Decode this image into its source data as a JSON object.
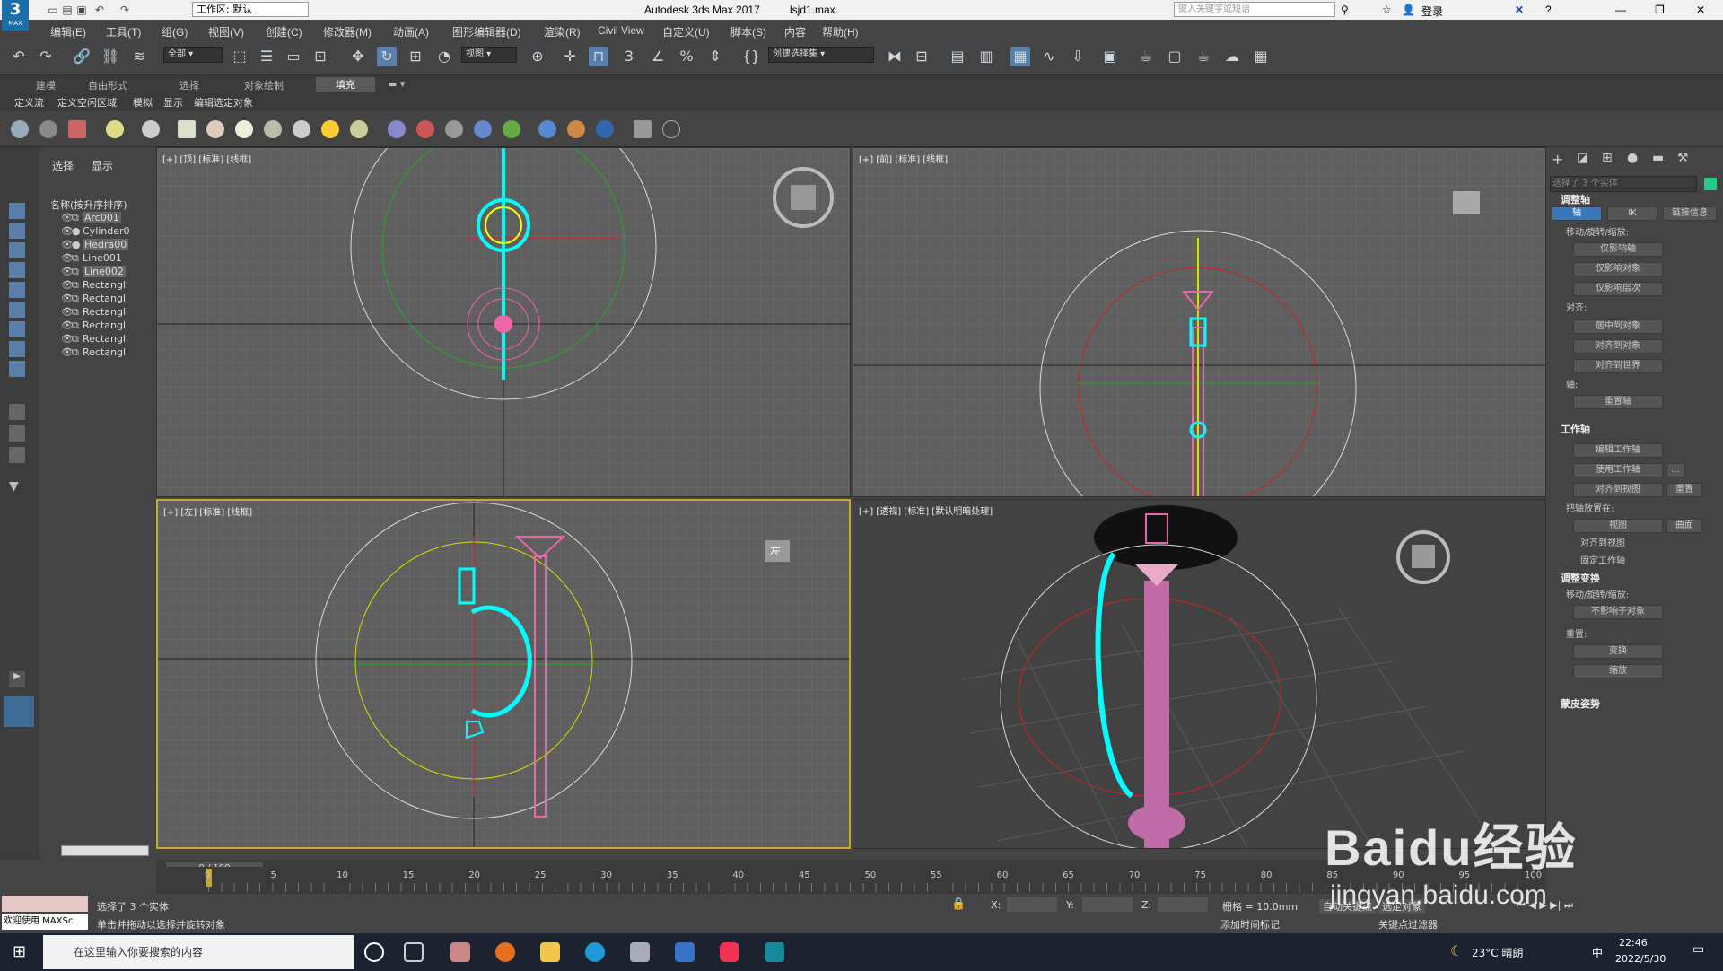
{
  "titlebar": {
    "app": "Autodesk 3ds Max 2017",
    "file": "lsjd1.max",
    "workspace": "工作区: 默认",
    "search_placeholder": "键入关键字或短语",
    "login": "登录",
    "logo": "3",
    "logo_sub": "MAX"
  },
  "menu": [
    "编辑(E)",
    "工具(T)",
    "组(G)",
    "视图(V)",
    "创建(C)",
    "修改器(M)",
    "动画(A)",
    "图形编辑器(D)",
    "渲染(R)",
    "Civil View",
    "自定义(U)",
    "脚本(S)",
    "内容",
    "帮助(H)"
  ],
  "toolbar": {
    "filter": "全部",
    "view_dropdown": "视图",
    "selection_set": "创建选择集"
  },
  "ribbon": {
    "tabs": [
      "建模",
      "自由形式",
      "选择",
      "对象绘制",
      "填充"
    ],
    "subtabs": [
      "定义流",
      "定义空闲区域",
      "模拟",
      "显示",
      "编辑选定对象"
    ]
  },
  "scene_explorer": {
    "tabs": [
      "选择",
      "显示"
    ],
    "header": "名称(按升序排序)",
    "items": [
      "Arc001",
      "Cylinder0",
      "Hedra00",
      "Line001",
      "Line002",
      "Rectangl",
      "Rectangl",
      "Rectangl",
      "Rectangl",
      "Rectangl",
      "Rectangl"
    ]
  },
  "viewports": {
    "top": "[+] [顶] [标准] [线框]",
    "front": "[+] [前] [标准] [线框]",
    "left": "[+] [左] [标准] [线框]",
    "persp": "[+] [透视] [标准] [默认明暗处理]",
    "viewcube_left": "左"
  },
  "command_panel": {
    "selection": "选择了 3 个实体",
    "tabs": [
      "轴",
      "IK",
      "链接信息"
    ],
    "adjust_pivot": "调整轴",
    "move_rotate_scale": "移动/旋转/缩放:",
    "btn_pivot_only": "仅影响轴",
    "btn_object_only": "仅影响对象",
    "btn_hierarchy_only": "仅影响层次",
    "align": "对齐:",
    "btn_center": "居中到对象",
    "btn_align_obj": "对齐到对象",
    "btn_align_world": "对齐到世界",
    "pivot": "轴:",
    "btn_reset_pivot": "重置轴",
    "working_pivot": "工作轴",
    "btn_edit_wp": "编辑工作轴",
    "btn_use_wp": "使用工作轴",
    "btn_ellipsis": "...",
    "btn_align_view": "对齐到视图",
    "btn_reset": "重置",
    "place_pivot": "把轴放置在:",
    "btn_view": "视图",
    "btn_surface": "曲面",
    "chk_align_view": "对齐到视图",
    "chk_lock_wp": "固定工作轴",
    "adjust_transform": "调整变换",
    "btn_dont_affect": "不影响子对象",
    "reset": "重置:",
    "btn_transform": "变换",
    "btn_scale": "缩放",
    "skin_pose": "蒙皮姿势"
  },
  "timeline": {
    "frame": "0 / 100",
    "ticks": [
      "0",
      "5",
      "10",
      "15",
      "20",
      "25",
      "30",
      "35",
      "40",
      "45",
      "50",
      "55",
      "60",
      "65",
      "70",
      "75",
      "80",
      "85",
      "90",
      "95",
      "100"
    ]
  },
  "status": {
    "welcome": "欢迎使用 MAXSc",
    "selected": "选择了 3 个实体",
    "hint": "单击并拖动以选择并旋转对象",
    "x": "X:",
    "y": "Y:",
    "z": "Z:",
    "grid": "栅格 = 10.0mm",
    "add_time_tag": "添加时间标记",
    "auto_key": "自动关键点",
    "set_key": "选定对象",
    "key_filters": "关键点过滤器"
  },
  "taskbar": {
    "search": "在这里输入你要搜索的内容",
    "weather": "23°C 晴朗",
    "ime": "中",
    "time": "22:46",
    "date": "2022/5/30"
  },
  "watermark": {
    "brand": "Baidu经验",
    "url": "jingyan.baidu.com"
  }
}
